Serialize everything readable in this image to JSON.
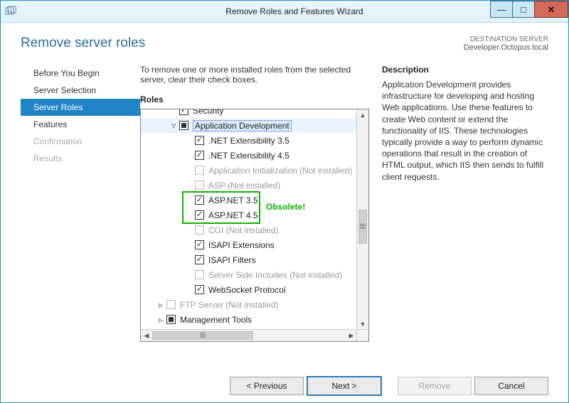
{
  "titlebar": {
    "title": "Remove Roles and Features Wizard"
  },
  "page_heading": "Remove server roles",
  "destination": {
    "label": "DESTINATION SERVER",
    "server": "Developer.Octopus.local"
  },
  "instruction": "To remove one or more installed roles from the selected server, clear their check boxes.",
  "nav": {
    "items": [
      {
        "label": "Before You Begin",
        "state": "normal"
      },
      {
        "label": "Server Selection",
        "state": "normal"
      },
      {
        "label": "Server Roles",
        "state": "active"
      },
      {
        "label": "Features",
        "state": "normal"
      },
      {
        "label": "Confirmation",
        "state": "disabled"
      },
      {
        "label": "Results",
        "state": "disabled"
      }
    ]
  },
  "roles_label": "Roles",
  "description_label": "Description",
  "description_text": "Application Development provides infrastructure for developing and hosting Web applications. Use these features to create Web content or extend the functionality of IIS. These technologies typically provide a way to perform dynamic operations that result in the creation of HTML output, which IIS then sends to fulfill client requests.",
  "tree": {
    "items": [
      {
        "level": 2,
        "glyph": "",
        "check": "checked",
        "label": "Security",
        "dim": false,
        "cutoff": true
      },
      {
        "level": 2,
        "glyph": "▿",
        "check": "mixed",
        "label": "Application Development",
        "selected": true
      },
      {
        "level": 3,
        "glyph": "",
        "check": "checked",
        "label": ".NET Extensibility 3.5"
      },
      {
        "level": 3,
        "glyph": "",
        "check": "checked",
        "label": ".NET Extensibility 4.5"
      },
      {
        "level": 3,
        "glyph": "",
        "check": "unchecked",
        "label": "Application Initialization (Not installed)",
        "dim": true
      },
      {
        "level": 3,
        "glyph": "",
        "check": "unchecked",
        "label": "ASP (Not installed)",
        "dim": true
      },
      {
        "level": 3,
        "glyph": "",
        "check": "checked",
        "label": "ASP.NET 3.5",
        "annot": true
      },
      {
        "level": 3,
        "glyph": "",
        "check": "checked",
        "label": "ASP.NET 4.5",
        "annot": true
      },
      {
        "level": 3,
        "glyph": "",
        "check": "unchecked",
        "label": "CGI (Not installed)",
        "dim": true
      },
      {
        "level": 3,
        "glyph": "",
        "check": "checked",
        "label": "ISAPI Extensions"
      },
      {
        "level": 3,
        "glyph": "",
        "check": "checked",
        "label": "ISAPI Filters"
      },
      {
        "level": 3,
        "glyph": "",
        "check": "unchecked",
        "label": "Server Side Includes (Not installed)",
        "dim": true
      },
      {
        "level": 3,
        "glyph": "",
        "check": "checked",
        "label": "WebSocket Protocol"
      },
      {
        "level": 1,
        "glyph": "▹",
        "check": "unchecked",
        "label": "FTP Server (Not installed)",
        "dim": true
      },
      {
        "level": 1,
        "glyph": "▹",
        "check": "mixed",
        "label": "Management Tools"
      }
    ]
  },
  "annotation": {
    "label": "Obsolete!"
  },
  "buttons": {
    "previous": "< Previous",
    "next": "Next >",
    "remove": "Remove",
    "cancel": "Cancel"
  }
}
